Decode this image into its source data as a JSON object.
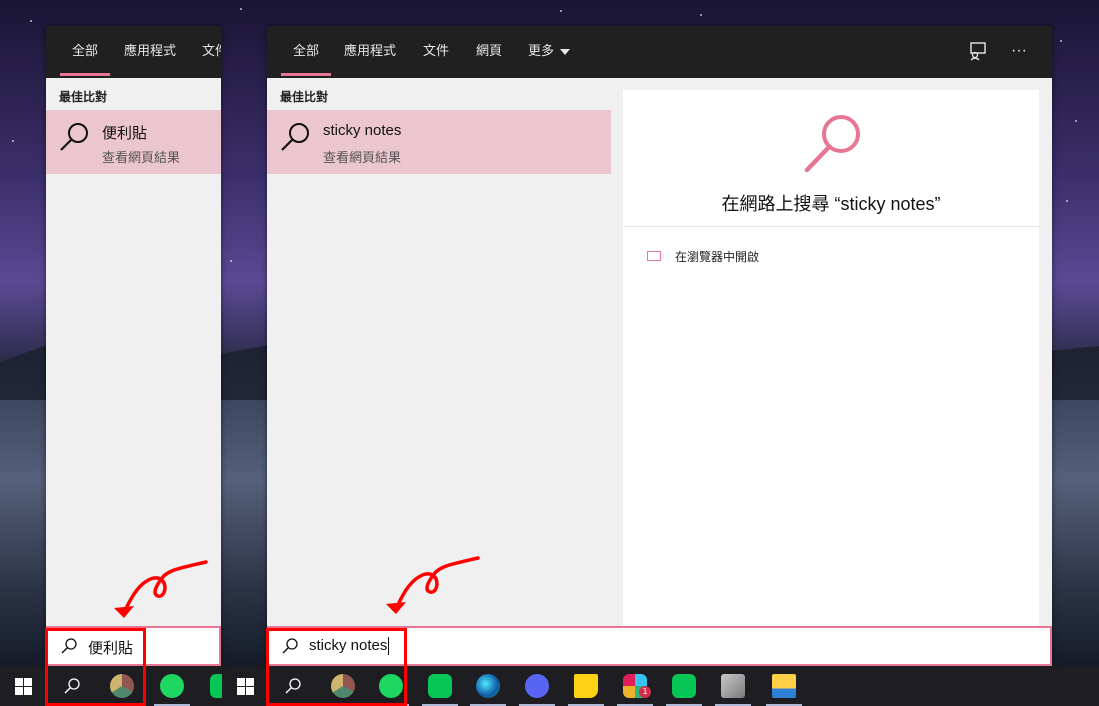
{
  "left_window": {
    "tabs": [
      "全部",
      "應用程式",
      "文件"
    ],
    "section_label": "最佳比對",
    "best_match": {
      "title": "便利貼",
      "subtitle": "查看網頁結果"
    },
    "search_value": "便利貼"
  },
  "right_window": {
    "tabs": [
      "全部",
      "應用程式",
      "文件",
      "網頁",
      "更多"
    ],
    "section_label": "最佳比對",
    "best_match": {
      "title": "sticky notes",
      "subtitle": "查看網頁結果"
    },
    "preview": {
      "heading": "在網路上搜尋 “sticky notes”",
      "open_in_browser": "在瀏覽器中開啟"
    },
    "search_value": "sticky notes"
  },
  "taskbar": {
    "icons": [
      "windows-start-icon",
      "search-icon",
      "chrome-icon",
      "spotify-icon",
      "line-icon",
      "edge-icon",
      "discord-icon",
      "sticky-notes-icon",
      "slack-icon",
      "line-icon",
      "media-player-icon",
      "file-explorer-icon"
    ],
    "slack_badge": "1"
  },
  "colors": {
    "accent": "#e67693",
    "highlight": "#ecc6cf",
    "annotation": "#ff0000",
    "taskbar": "#1e1e22"
  }
}
